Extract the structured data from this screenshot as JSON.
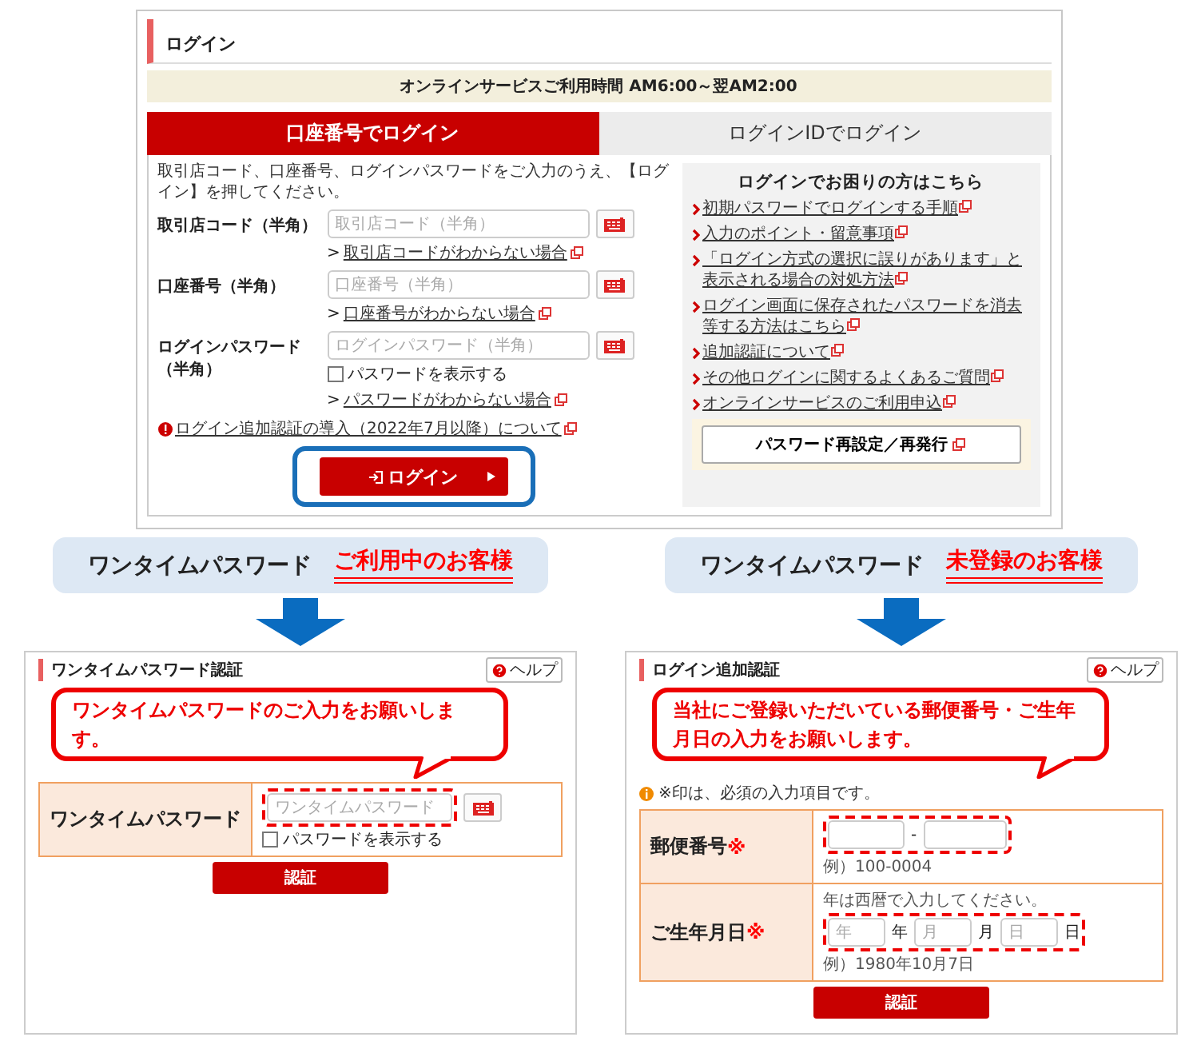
{
  "login_screen": {
    "title": "ログイン",
    "notice": "オンラインサービスご利用時間 AM6:00～翌AM2:00",
    "tabs": [
      {
        "label": "口座番号でログイン",
        "selected": true
      },
      {
        "label": "ログインIDでログイン",
        "selected": false
      }
    ],
    "instruction": "取引店コード、口座番号、ログインパスワードをご入力のうえ、【ログイン】を押してください。",
    "fields": [
      {
        "label": "取引店コード（半角）",
        "placeholder": "取引店コード（半角）",
        "marker": ">",
        "help_link": "取引店コードがわからない場合"
      },
      {
        "label": "口座番号（半角）",
        "placeholder": "口座番号（半角）",
        "marker": ">",
        "help_link": "口座番号がわからない場合"
      },
      {
        "label": "ログインパスワード（半角）",
        "placeholder": "ログインパスワード（半角）",
        "show_password": {
          "label": "パスワードを表示する",
          "checked": false
        },
        "marker": ">",
        "help_link": "パスワードがわからない場合"
      }
    ],
    "notice_link": "ログイン追加認証の導入（2022年7月以降）について",
    "login_button": {
      "label": "ログイン",
      "highlighted": true
    },
    "help_panel": {
      "title": "ログインでお困りの方はこちら",
      "links": [
        "初期パスワードでログインする手順",
        "入力のポイント・留意事項",
        "「ログイン方式の選択に誤りがあります」と表示される場合の対処方法",
        "ログイン画面に保存されたパスワードを消去等する方法はこちら",
        "追加認証について",
        "その他ログインに関するよくあるご質問",
        "オンラインサービスのご利用申込"
      ],
      "reset_button": "パスワード再設定／再発行"
    }
  },
  "cases": [
    {
      "heading": "ワンタイムパスワード",
      "audience": "ご利用中のお客様",
      "screen": {
        "title": "ワンタイムパスワード認証",
        "help_label": "ヘルプ",
        "callout": "ワンタイムパスワードのご入力をお願いします。",
        "rows": [
          {
            "kind": "password",
            "label": "ワンタイムパスワード",
            "placeholder": "ワンタイムパスワード",
            "highlighted": true,
            "show_password": {
              "label": "パスワードを表示する",
              "checked": false
            }
          }
        ],
        "submit": "認証"
      }
    },
    {
      "heading": "ワンタイムパスワード",
      "audience": "未登録のお客様",
      "screen": {
        "title": "ログイン追加認証",
        "help_label": "ヘルプ",
        "callout": "当社にご登録いただいている郵便番号・ご生年月日の入力をお願いします。",
        "note": "※印は、必須の入力項目です。",
        "rows": [
          {
            "kind": "postal",
            "label": "郵便番号",
            "required_mark": "※",
            "separator": "-",
            "highlighted": true,
            "hint": "例）100-0004"
          },
          {
            "kind": "date",
            "label": "ご生年月日",
            "required_mark": "※",
            "note": "年は西暦で入力してください。",
            "highlighted": true,
            "parts": [
              {
                "placeholder": "年",
                "unit": "年"
              },
              {
                "placeholder": "月",
                "unit": "月"
              },
              {
                "placeholder": "日",
                "unit": "日"
              }
            ],
            "hint": "例）1980年10月7日"
          }
        ],
        "submit": "認証"
      }
    }
  ]
}
